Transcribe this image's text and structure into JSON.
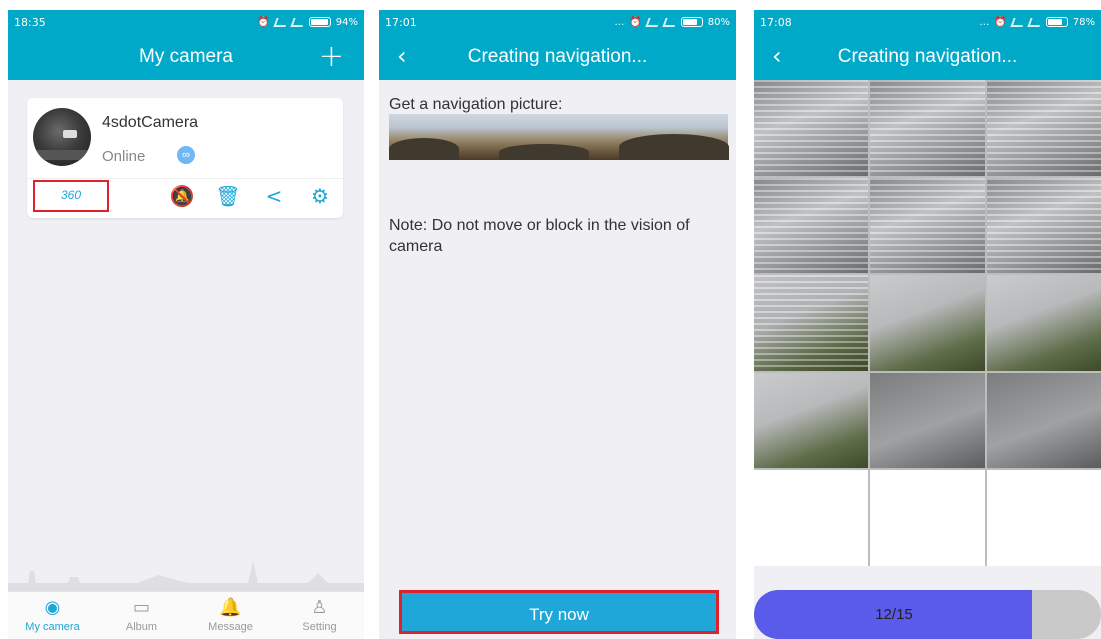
{
  "screens": [
    {
      "status": {
        "time": "18:35",
        "battery": "94%",
        "battery_level": 0.94
      },
      "title": "My camera",
      "add_icon": "plus-icon",
      "camera": {
        "name": "4sdotCamera",
        "status": "Online",
        "badge_360": "360"
      },
      "card_icons": [
        "alarm-off-icon",
        "trash-icon",
        "share-icon",
        "settings-icon"
      ],
      "tabs": [
        {
          "label": "My camera",
          "icon": "camera-icon",
          "active": true
        },
        {
          "label": "Album",
          "icon": "album-icon",
          "active": false
        },
        {
          "label": "Message",
          "icon": "bell-icon",
          "active": false
        },
        {
          "label": "Setting",
          "icon": "user-icon",
          "active": false
        }
      ]
    },
    {
      "status": {
        "time": "17:01",
        "battery": "80%",
        "battery_level": 0.8
      },
      "title": "Creating navigation...",
      "nav_label": "Get a navigation picture:",
      "note": "Note: Do not move or block in the vision of camera",
      "button": "Try now"
    },
    {
      "status": {
        "time": "17:08",
        "battery": "78%",
        "battery_level": 0.78
      },
      "title": "Creating navigation...",
      "progress": {
        "text": "12/15",
        "current": 12,
        "total": 15
      }
    }
  ],
  "colors": {
    "accent": "#00a9c8",
    "highlight": "#e0202a",
    "progress": "#5a5aeb"
  }
}
